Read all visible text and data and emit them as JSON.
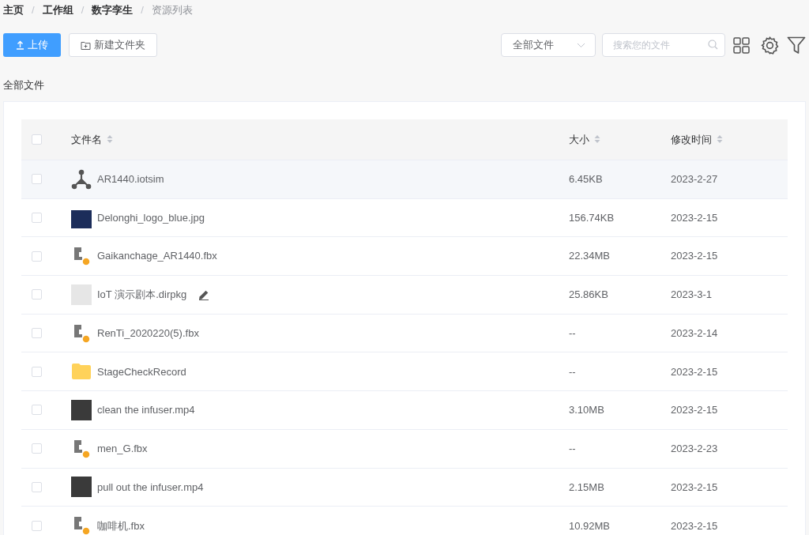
{
  "breadcrumb": [
    {
      "label": "主页",
      "current": false
    },
    {
      "separator": "/",
      "label": "工作组",
      "current": false
    },
    {
      "separator": "/",
      "label": "数字孪生",
      "current": false
    },
    {
      "separator": "/",
      "label": "资源列表",
      "current": true
    }
  ],
  "toolbar": {
    "upload_button": "上传",
    "new_folder_button": "新建文件夹",
    "filter_select": "全部文件",
    "search": {
      "placeholder": "搜索您的文件"
    }
  },
  "section_title": "全部文件",
  "table": {
    "select_all_checked": false,
    "columns": [
      "文件名",
      "大小",
      "修改时间"
    ],
    "rows": [
      {
        "kind": "network",
        "name": "AR1440.iotsim",
        "size": "6.45KB",
        "modified": "2023-2-27",
        "highlighted": true,
        "editable": false
      },
      {
        "kind": "image",
        "name": "Delonghi_logo_blue.jpg",
        "size": "156.74KB",
        "modified": "2023-2-15",
        "highlighted": false,
        "editable": false
      },
      {
        "kind": "model",
        "name": "Gaikanchage_AR1440.fbx",
        "size": "22.34MB",
        "modified": "2023-2-15",
        "highlighted": false,
        "editable": false
      },
      {
        "kind": "package",
        "name": "IoT 演示剧本.dirpkg",
        "size": "25.86KB",
        "modified": "2023-3-1",
        "highlighted": false,
        "editable": true
      },
      {
        "kind": "model",
        "name": "RenTi_2020220(5).fbx",
        "size": "--",
        "modified": "2023-2-14",
        "highlighted": false,
        "editable": false
      },
      {
        "kind": "folder",
        "name": "StageCheckRecord",
        "size": "--",
        "modified": "2023-2-15",
        "highlighted": false,
        "editable": false
      },
      {
        "kind": "video",
        "name": "clean the infuser.mp4",
        "size": "3.10MB",
        "modified": "2023-2-15",
        "highlighted": false,
        "editable": false
      },
      {
        "kind": "model",
        "name": "men_G.fbx",
        "size": "--",
        "modified": "2023-2-23",
        "highlighted": false,
        "editable": false
      },
      {
        "kind": "video",
        "name": "pull out the infuser.mp4",
        "size": "2.15MB",
        "modified": "2023-2-15",
        "highlighted": false,
        "editable": false
      },
      {
        "kind": "model",
        "name": "咖啡机.fbx",
        "size": "10.92MB",
        "modified": "2023-2-15",
        "highlighted": false,
        "editable": false
      }
    ]
  }
}
